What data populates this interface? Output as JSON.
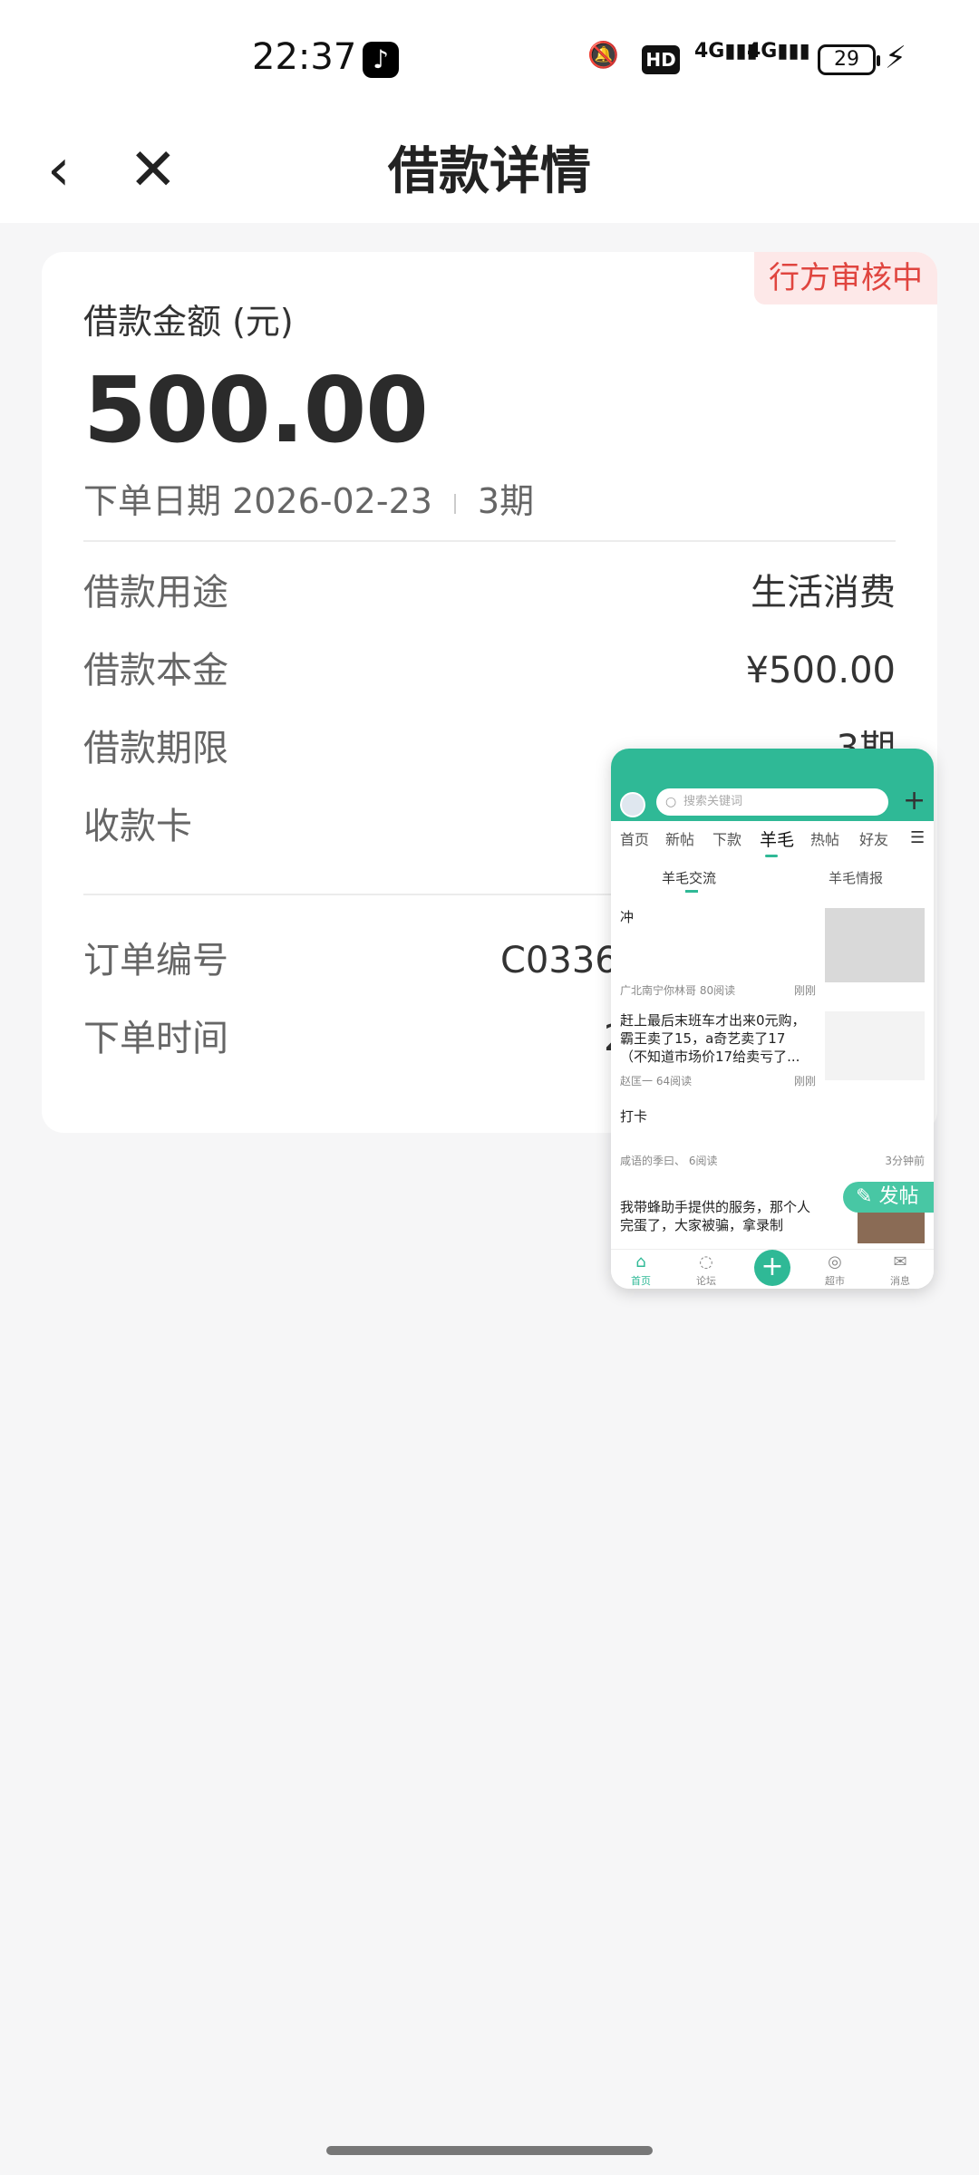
{
  "status_bar": {
    "time": "22:37",
    "battery": "29",
    "network": "4G",
    "hd_label": "HD"
  },
  "nav": {
    "title": "借款详情"
  },
  "loan": {
    "status_badge": "行方审核中",
    "amount_label": "借款金额 (元)",
    "amount": "500.00",
    "order_date": "下单日期 2026-02-23",
    "periods": "3期",
    "details": [
      {
        "label": "借款用途",
        "value": "生活消费"
      },
      {
        "label": "借款本金",
        "value": "¥500.00"
      },
      {
        "label": "借款期限",
        "value": "3期"
      },
      {
        "label": "收款卡",
        "value": ""
      }
    ],
    "order_info": [
      {
        "label": "订单编号",
        "value": "C0336260"
      },
      {
        "label": "下单时间",
        "value": "202"
      }
    ]
  },
  "mini_window": {
    "search_placeholder": "搜索关键词",
    "tabs": [
      "首页",
      "新帖",
      "下款",
      "羊毛",
      "热帖",
      "好友"
    ],
    "active_tab": "羊毛",
    "subtabs": [
      "羊毛交流",
      "羊毛情报"
    ],
    "posts": [
      {
        "title": "冲",
        "meta": "广北南宁你林哥  80阅读",
        "time": "刚刚"
      },
      {
        "title": "赶上最后末班车才出来0元购，霸王卖了15，a奇艺卖了17（不知道市场价17给卖亏了...",
        "meta": "赵匡一  64阅读",
        "time": "刚刚"
      },
      {
        "title": "打卡",
        "meta": "咸语的季曰、  6阅读",
        "time": "3分钟前"
      },
      {
        "title": "我带蜂助手提供的服务，那个人完蛋了，大家被骗，拿录制",
        "meta": "",
        "time": ""
      }
    ],
    "fab_label": "发帖",
    "bottom_nav": [
      "首页",
      "论坛",
      "",
      "超市",
      "消息"
    ]
  }
}
